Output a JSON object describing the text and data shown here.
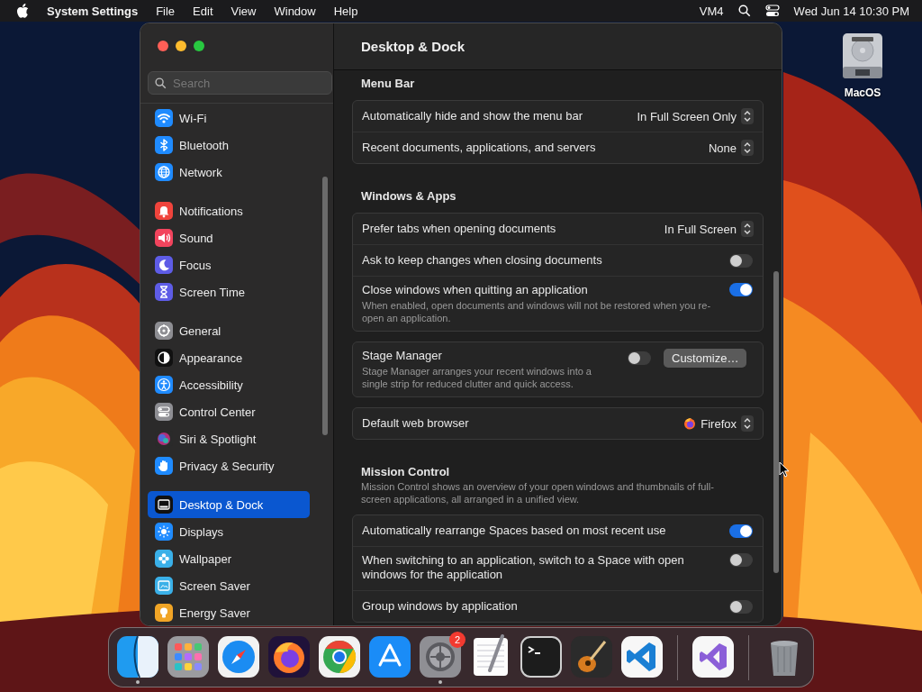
{
  "menu_bar": {
    "app_name": "System Settings",
    "menus": [
      "File",
      "Edit",
      "View",
      "Window",
      "Help"
    ],
    "status_text": "VM4",
    "clock": "Wed Jun 14 10:30 PM"
  },
  "desktop_icons": [
    {
      "label": "MacOS"
    }
  ],
  "window": {
    "title": "Desktop & Dock",
    "search": {
      "placeholder": "Search"
    },
    "sidebar_groups": [
      [
        {
          "label": "Wi-Fi",
          "kind": "wifi",
          "selected": false
        },
        {
          "label": "Bluetooth",
          "kind": "bluetooth",
          "selected": false
        },
        {
          "label": "Network",
          "kind": "network",
          "selected": false
        }
      ],
      [
        {
          "label": "Notifications",
          "kind": "notifications",
          "selected": false
        },
        {
          "label": "Sound",
          "kind": "sound",
          "selected": false
        },
        {
          "label": "Focus",
          "kind": "focus",
          "selected": false
        },
        {
          "label": "Screen Time",
          "kind": "screentime",
          "selected": false
        }
      ],
      [
        {
          "label": "General",
          "kind": "general",
          "selected": false
        },
        {
          "label": "Appearance",
          "kind": "appearance",
          "selected": false
        },
        {
          "label": "Accessibility",
          "kind": "accessibility",
          "selected": false
        },
        {
          "label": "Control Center",
          "kind": "controlcenter",
          "selected": false
        },
        {
          "label": "Siri & Spotlight",
          "kind": "siri",
          "selected": false
        },
        {
          "label": "Privacy & Security",
          "kind": "privacy",
          "selected": false
        }
      ],
      [
        {
          "label": "Desktop & Dock",
          "kind": "dock",
          "selected": true
        },
        {
          "label": "Displays",
          "kind": "displays",
          "selected": false
        },
        {
          "label": "Wallpaper",
          "kind": "wallpaper",
          "selected": false
        },
        {
          "label": "Screen Saver",
          "kind": "screensaver",
          "selected": false
        },
        {
          "label": "Energy Saver",
          "kind": "energy",
          "selected": false
        }
      ]
    ],
    "sections": [
      {
        "title": "Menu Bar",
        "rows": [
          {
            "kind": "popup",
            "label": "Automatically hide and show the menu bar",
            "value": "In Full Screen Only"
          },
          {
            "kind": "popup",
            "label": "Recent documents, applications, and servers",
            "value": "None"
          }
        ]
      },
      {
        "title": "Windows & Apps",
        "rows": [
          {
            "kind": "popup",
            "label": "Prefer tabs when opening documents",
            "value": "In Full Screen"
          },
          {
            "kind": "toggle",
            "label": "Ask to keep changes when closing documents",
            "on": false
          },
          {
            "kind": "toggle",
            "label": "Close windows when quitting an application",
            "description": "When enabled, open documents and windows will not be restored when you re-open an application.",
            "on": true
          }
        ]
      },
      {
        "rows": [
          {
            "kind": "toggle_button",
            "label": "Stage Manager",
            "description": "Stage Manager arranges your recent windows into a single strip for reduced clutter and quick access.",
            "on": false,
            "button": "Customize…"
          }
        ]
      },
      {
        "rows": [
          {
            "kind": "app_popup",
            "label": "Default web browser",
            "value": "Firefox"
          }
        ]
      },
      {
        "title": "Mission Control",
        "description": "Mission Control shows an overview of your open windows and thumbnails of full-screen applications, all arranged in a unified view.",
        "rows": [
          {
            "kind": "toggle",
            "label": "Automatically rearrange Spaces based on most recent use",
            "on": true
          },
          {
            "kind": "toggle",
            "label": "When switching to an application, switch to a Space with open windows for the application",
            "on": false
          },
          {
            "kind": "toggle",
            "label": "Group windows by application",
            "on": false
          }
        ]
      }
    ]
  },
  "dock": {
    "items": [
      {
        "kind": "finder",
        "running": true
      },
      {
        "kind": "launchpad",
        "running": false
      },
      {
        "kind": "safari",
        "running": false
      },
      {
        "kind": "firefox",
        "running": false
      },
      {
        "kind": "chrome",
        "running": false
      },
      {
        "kind": "appstore",
        "running": false
      },
      {
        "kind": "settings",
        "running": true,
        "badge": "2"
      },
      {
        "kind": "textedit",
        "running": false
      },
      {
        "kind": "terminal",
        "running": false
      },
      {
        "kind": "garageband",
        "running": false
      },
      {
        "kind": "vscode",
        "running": false
      },
      {
        "kind": "separator"
      },
      {
        "kind": "visualstudio",
        "running": false
      },
      {
        "kind": "separator"
      },
      {
        "kind": "trash",
        "running": false
      }
    ]
  }
}
